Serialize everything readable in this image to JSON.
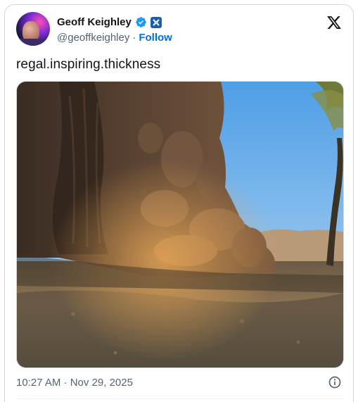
{
  "author": {
    "name": "Geoff Keighley",
    "handle": "@geoffkeighley",
    "separator": "·",
    "follow_label": "Follow"
  },
  "tweet": {
    "text": "regal.inspiring.thickness",
    "timestamp": "10:27 AM · Nov 29, 2025"
  },
  "icons": {
    "verified": "verified-badge-icon",
    "affiliate": "affiliate-badge-icon",
    "brand": "x-logo-icon",
    "info": "info-icon"
  },
  "colors": {
    "link": "#006fd6",
    "verified": "#1d9bf0",
    "muted": "#536471",
    "border": "#cfd9de"
  }
}
